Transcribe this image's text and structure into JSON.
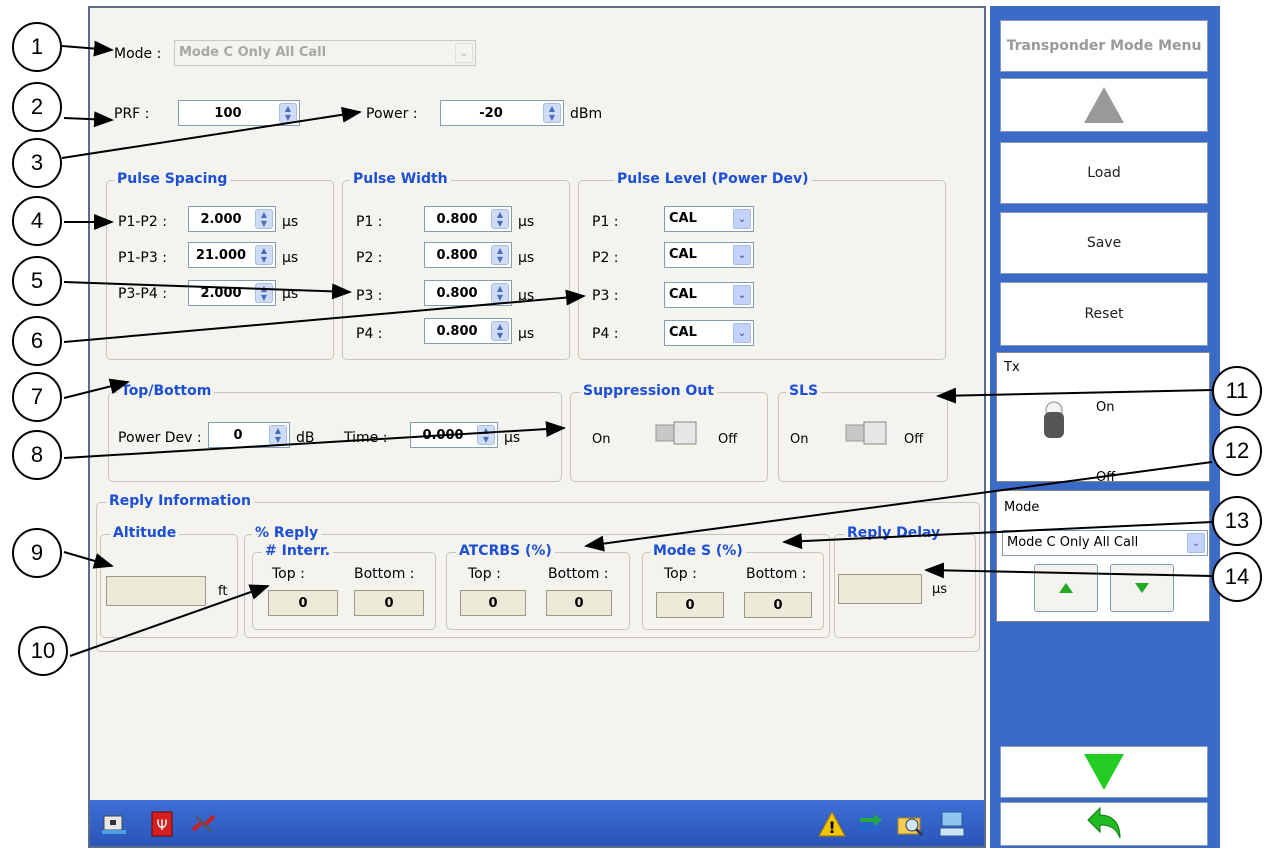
{
  "mode": {
    "label": "Mode :",
    "value": "Mode C Only All Call"
  },
  "prf": {
    "label": "PRF :",
    "value": "100"
  },
  "power": {
    "label": "Power :",
    "value": "-20",
    "unit": "dBm"
  },
  "pulse_spacing": {
    "title": "Pulse Spacing",
    "unit": "µs",
    "rows": [
      {
        "label": "P1-P2 :",
        "value": "2.000"
      },
      {
        "label": "P1-P3 :",
        "value": "21.000"
      },
      {
        "label": "P3-P4 :",
        "value": "2.000"
      }
    ]
  },
  "pulse_width": {
    "title": "Pulse Width",
    "unit": "µs",
    "rows": [
      {
        "label": "P1 :",
        "value": "0.800"
      },
      {
        "label": "P2 :",
        "value": "0.800"
      },
      {
        "label": "P3 :",
        "value": "0.800"
      },
      {
        "label": "P4 :",
        "value": "0.800"
      }
    ]
  },
  "pulse_level": {
    "title": "Pulse Level (Power Dev)",
    "rows": [
      {
        "label": "P1 :",
        "value": "CAL"
      },
      {
        "label": "P2 :",
        "value": "CAL"
      },
      {
        "label": "P3 :",
        "value": "CAL"
      },
      {
        "label": "P4 :",
        "value": "CAL"
      }
    ]
  },
  "top_bottom": {
    "title": "Top/Bottom",
    "power_dev_label": "Power Dev :",
    "power_dev_value": "0",
    "power_dev_unit": "dB",
    "time_label": "Time :",
    "time_value": "0.000",
    "time_unit": "µs"
  },
  "suppression_out": {
    "title": "Suppression Out",
    "on": "On",
    "off": "Off"
  },
  "sls": {
    "title": "SLS",
    "on": "On",
    "off": "Off"
  },
  "reply_info": {
    "title": "Reply Information",
    "altitude": {
      "title": "Altitude",
      "unit": "ft"
    },
    "pct_reply": "% Reply",
    "interr": {
      "title": "# Interr.",
      "top_label": "Top :",
      "bottom_label": "Bottom :",
      "top": "0",
      "bottom": "0"
    },
    "atcrbs": {
      "title": "ATCRBS (%)",
      "top_label": "Top :",
      "bottom_label": "Bottom :",
      "top": "0",
      "bottom": "0"
    },
    "modes": {
      "title": "Mode S (%)",
      "top_label": "Top :",
      "bottom_label": "Bottom :",
      "top": "0",
      "bottom": "0"
    },
    "reply_delay": {
      "title": "Reply Delay",
      "unit": "µs"
    }
  },
  "side": {
    "title": "Transponder Mode Menu",
    "load": "Load",
    "save": "Save",
    "reset": "Reset",
    "tx_label": "Tx",
    "tx_on": "On",
    "tx_off": "Off",
    "mode_label": "Mode",
    "mode_value": "Mode C Only All Call"
  },
  "callouts": [
    "1",
    "2",
    "3",
    "4",
    "5",
    "6",
    "7",
    "8",
    "9",
    "10",
    "11",
    "12",
    "13",
    "14"
  ],
  "colors": {
    "group_title": "#1b4fd6",
    "side_panel": "#3a6cc7",
    "arrow_green": "#22cc22",
    "arrow_gray": "#999999"
  }
}
